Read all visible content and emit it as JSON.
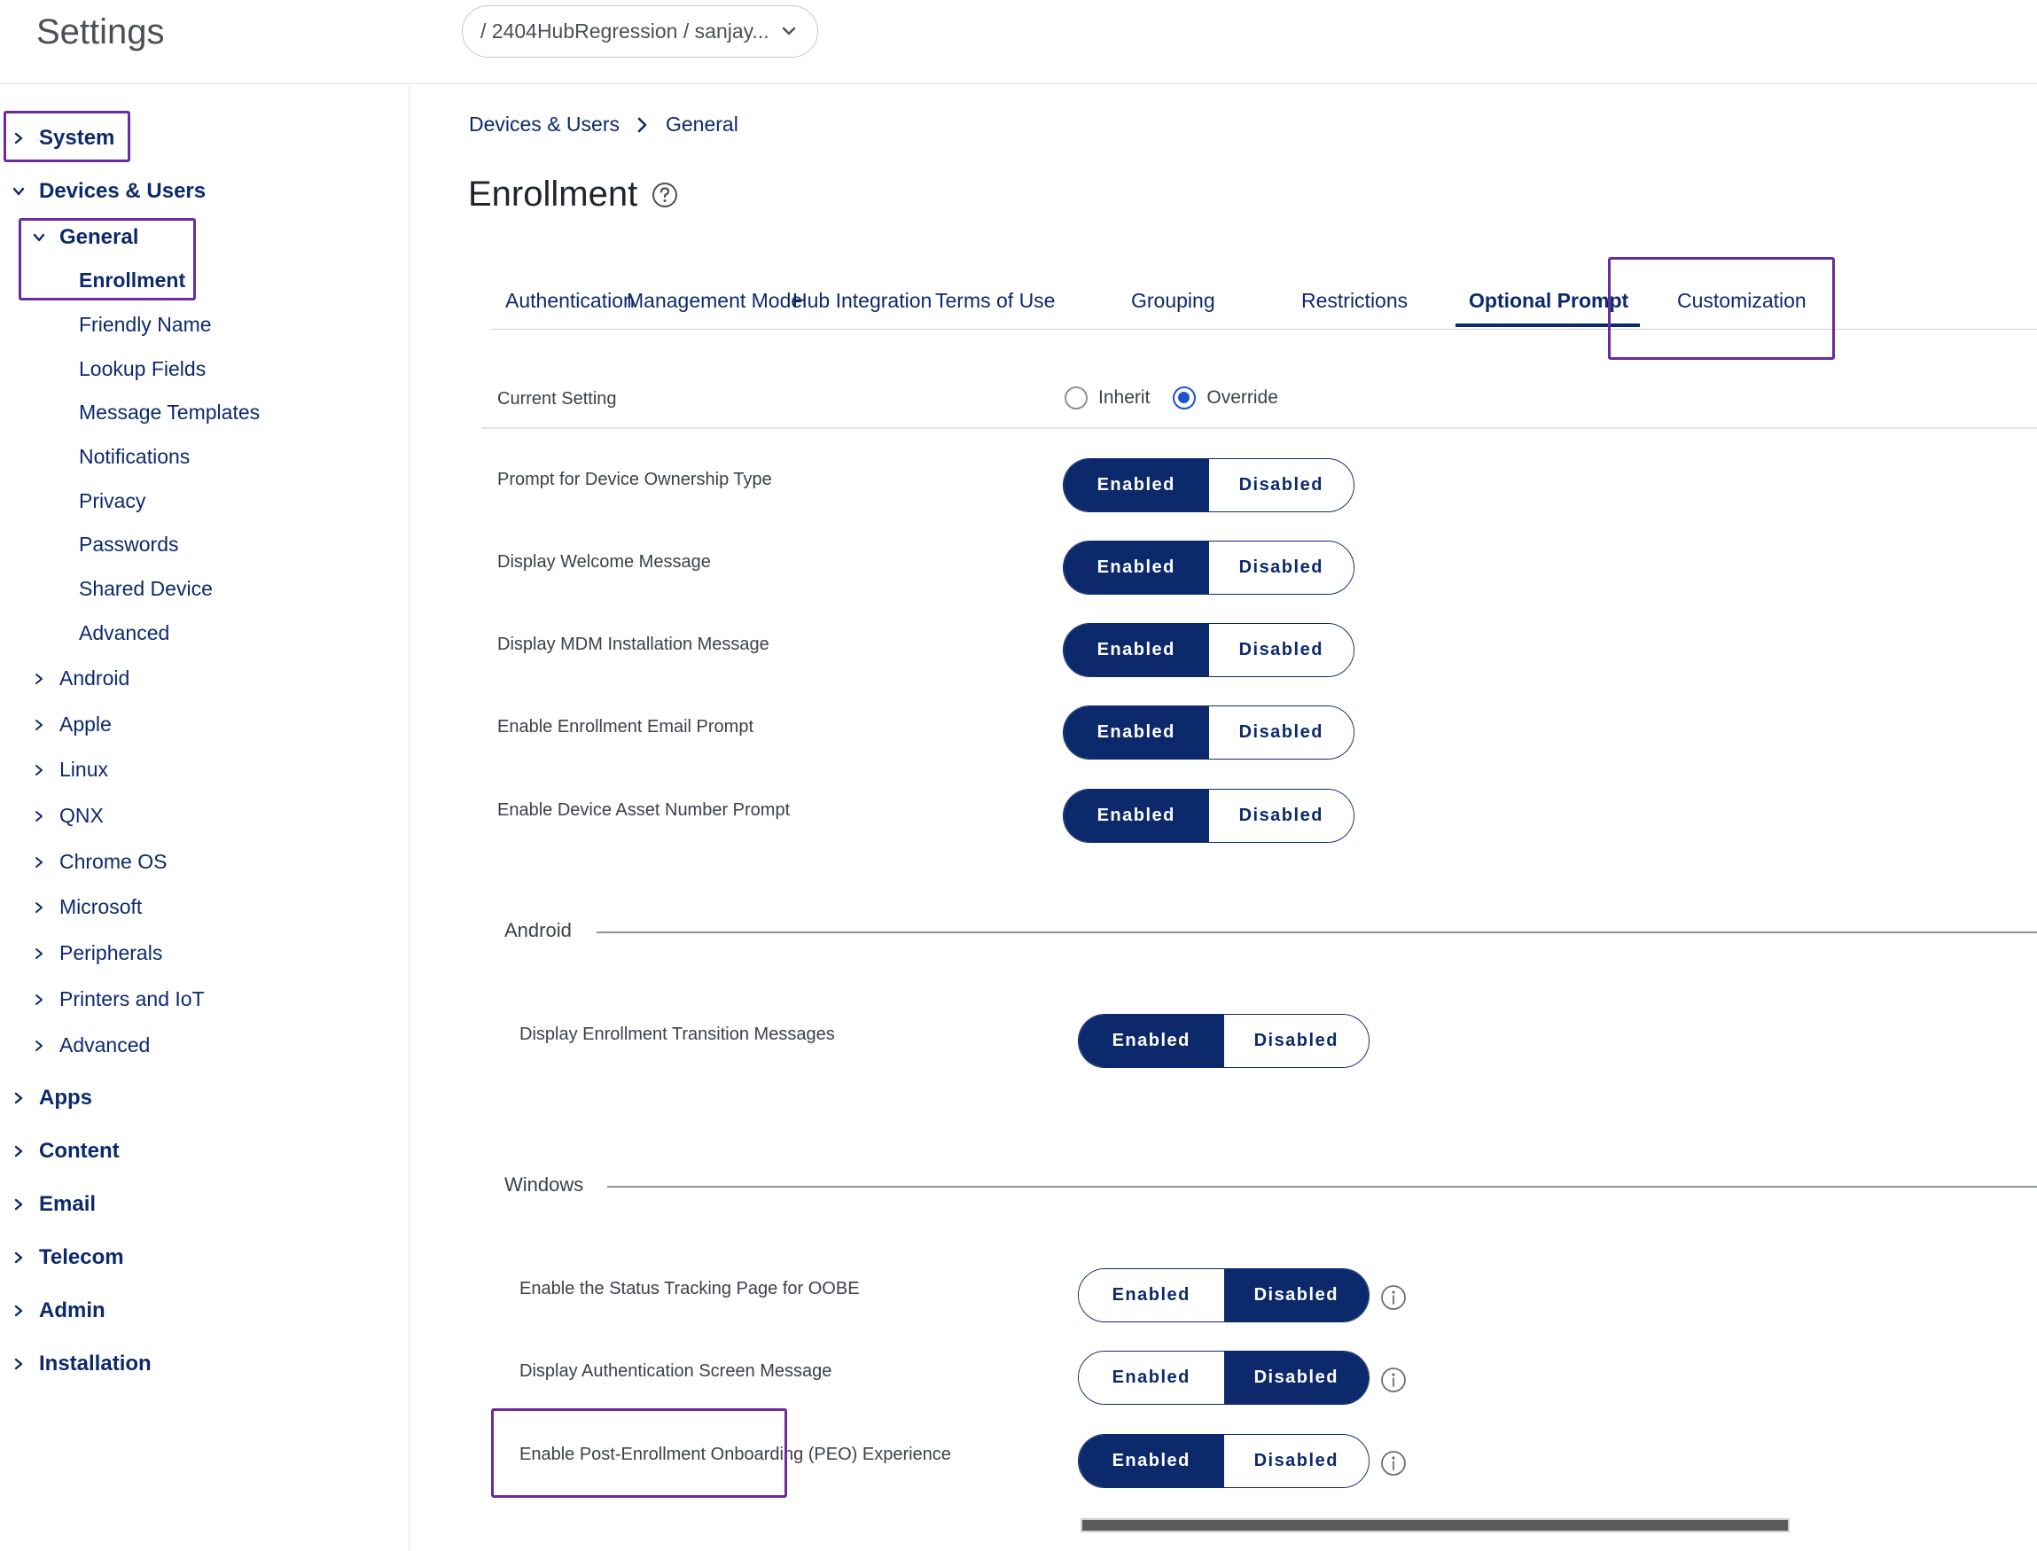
{
  "app_title": "Settings",
  "org_picker": {
    "label": "/ 2404HubRegression / sanjay..."
  },
  "sidebar": {
    "system": "System",
    "devices_users": "Devices & Users",
    "general": "General",
    "general_items": [
      "Enrollment",
      "Friendly Name",
      "Lookup Fields",
      "Message Templates",
      "Notifications",
      "Privacy",
      "Passwords",
      "Shared Device",
      "Advanced"
    ],
    "platforms": [
      "Android",
      "Apple",
      "Linux",
      "QNX",
      "Chrome OS",
      "Microsoft",
      "Peripherals",
      "Printers and IoT",
      "Advanced"
    ],
    "top_sections": [
      "Apps",
      "Content",
      "Email",
      "Telecom",
      "Admin",
      "Installation"
    ]
  },
  "breadcrumb": [
    "Devices & Users",
    "General"
  ],
  "page_title": "Enrollment",
  "tabs": [
    "Authentication",
    "Management Mode",
    "Hub Integration",
    "Terms of Use",
    "Grouping",
    "Restrictions",
    "Optional Prompt",
    "Customization"
  ],
  "active_tab": "Optional Prompt",
  "current_setting": {
    "label": "Current Setting",
    "options": [
      "Inherit",
      "Override"
    ],
    "selected": "Override"
  },
  "toggle_labels": {
    "on": "Enabled",
    "off": "Disabled"
  },
  "general_settings": [
    {
      "label": "Prompt for Device Ownership Type",
      "value": "Enabled"
    },
    {
      "label": "Display Welcome Message",
      "value": "Enabled"
    },
    {
      "label": "Display MDM Installation Message",
      "value": "Enabled"
    },
    {
      "label": "Enable Enrollment Email Prompt",
      "value": "Enabled"
    },
    {
      "label": "Enable Device Asset Number Prompt",
      "value": "Enabled"
    }
  ],
  "android_section": {
    "title": "Android",
    "settings": [
      {
        "label": "Display Enrollment Transition Messages",
        "value": "Enabled"
      }
    ]
  },
  "windows_section": {
    "title": "Windows",
    "settings": [
      {
        "label": "Enable the Status Tracking Page for OOBE",
        "value": "Disabled"
      },
      {
        "label": "Display Authentication Screen Message",
        "value": "Disabled"
      },
      {
        "label": "Enable Post-Enrollment Onboarding (PEO) Experience",
        "value": "Enabled"
      }
    ]
  },
  "colors": {
    "brand_navy": "#0c2a6b",
    "highlight_purple": "#6a2aa0",
    "radio_blue": "#1d56c9"
  }
}
